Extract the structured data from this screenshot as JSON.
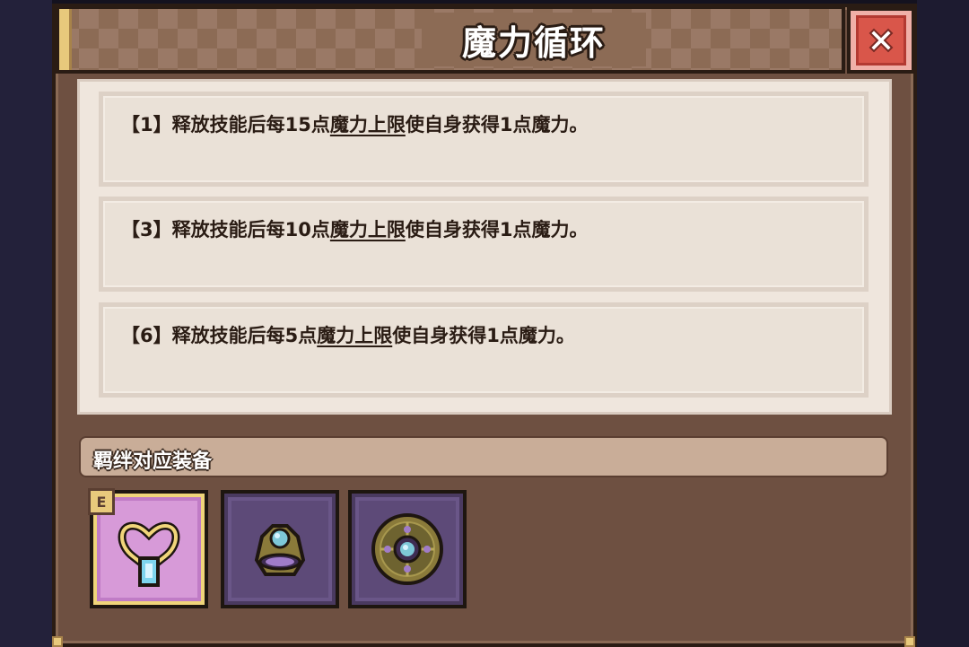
{
  "dialog": {
    "title": "魔力循环",
    "close_icon": "close-icon"
  },
  "entries": [
    {
      "prefix": "【1】释放技能后每15点",
      "link": "魔力上限",
      "suffix": "使自身获得1点魔力。"
    },
    {
      "prefix": "【3】释放技能后每10点",
      "link": "魔力上限",
      "suffix": "使自身获得1点魔力。"
    },
    {
      "prefix": "【6】释放技能后每5点",
      "link": "魔力上限",
      "suffix": "使自身获得1点魔力。"
    }
  ],
  "equipment_section": {
    "title": "羁绊对应装备",
    "items": [
      {
        "icon": "necklace-icon",
        "badge": "E",
        "rarity_color": "#d79ad8"
      },
      {
        "icon": "ring-icon",
        "rarity_color": "#5d4a78"
      },
      {
        "icon": "amulet-icon",
        "rarity_color": "#5d4a78"
      }
    ]
  },
  "colors": {
    "panel": "#6e5041",
    "content_bg": "#efe6dd",
    "close_red": "#d9564a",
    "gold": "#e8c97c"
  }
}
